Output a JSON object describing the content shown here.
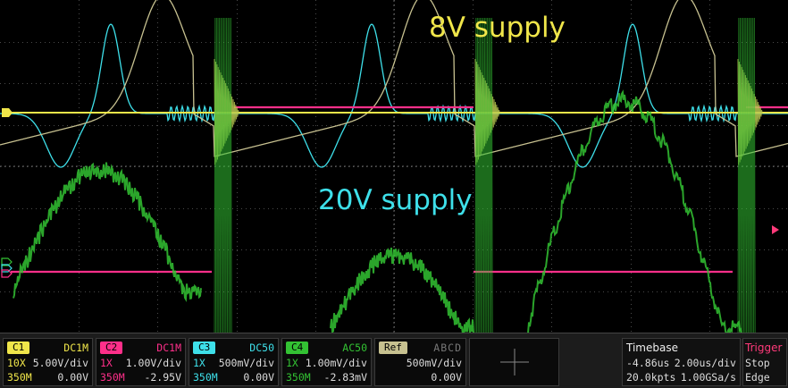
{
  "annotations": {
    "supply_8v": "8V supply",
    "supply_20v": "20V supply"
  },
  "colors": {
    "ch1": "#f0e64a",
    "ch2": "#ff2f8a",
    "ch3": "#3ee0ea",
    "ch4": "#33c233",
    "ref": "#c7c190",
    "grid": "#4a4a4a",
    "trigger": "#ff3a7a"
  },
  "channels": [
    {
      "label": "C1",
      "coupling": "DC1M",
      "probe": "10X",
      "scale": "5.00V/div",
      "bandwidth": "350M",
      "offset": "0.00V"
    },
    {
      "label": "C2",
      "coupling": "DC1M",
      "probe": "1X",
      "scale": "1.00V/div",
      "bandwidth": "350M",
      "offset": "-2.95V"
    },
    {
      "label": "C3",
      "coupling": "DC50",
      "probe": "1X",
      "scale": "500mV/div",
      "bandwidth": "350M",
      "offset": "0.00V"
    },
    {
      "label": "C4",
      "coupling": "AC50",
      "probe": "1X",
      "scale": "1.00mV/div",
      "bandwidth": "350M",
      "offset": "-2.83mV"
    }
  ],
  "ref": {
    "label": "Ref",
    "channels": "ABCD",
    "scale": "500mV/div",
    "offset": "0.00V"
  },
  "timebase": {
    "title": "Timebase",
    "delay": "-4.86us",
    "scale": "2.00us/div",
    "points": "20.0kpts",
    "rate": "1.00GSa/s"
  },
  "trigger": {
    "title": "Trigger",
    "state": "Stop",
    "mode": "Edge"
  }
}
